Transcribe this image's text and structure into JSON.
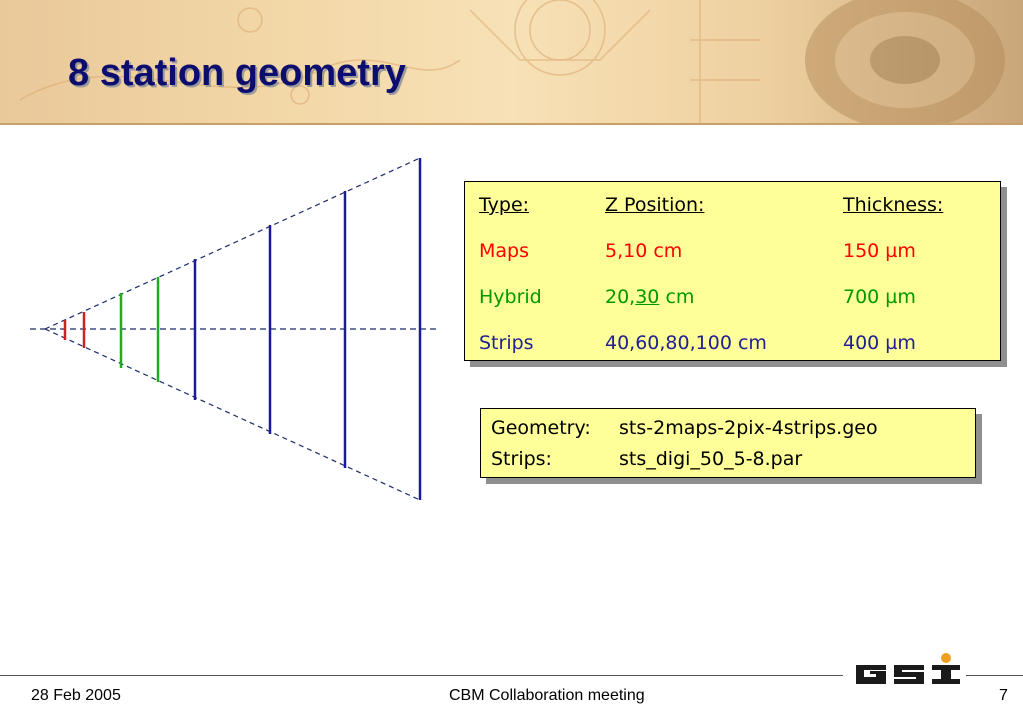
{
  "slide": {
    "title": "8 station geometry",
    "header_background_colors": [
      "#e9c89a",
      "#f7e1b6",
      "#c9a67a"
    ],
    "title_color": "#0c0d6e"
  },
  "diagram": {
    "description_icon": "detector-station-cone",
    "station_colors": {
      "maps": "#cc2222",
      "hybrid": "#22aa22",
      "strips": "#1a1a9a"
    }
  },
  "table": {
    "headers": [
      "Type:",
      "Z Position:",
      "Thickness:"
    ],
    "rows": [
      {
        "type": "Maps",
        "z_before": "5,10 cm",
        "z_under": "",
        "z_after": "",
        "thickness": "150 µm",
        "color": "#ff0000"
      },
      {
        "type": "Hybrid",
        "z_before": "20,",
        "z_under": "30",
        "z_after": " cm",
        "thickness": "700 µm",
        "color": "#009900"
      },
      {
        "type": "Strips",
        "z_before": "40,60,80,100 cm",
        "z_under": "",
        "z_after": "",
        "thickness": "400 µm",
        "color": "#202090"
      }
    ],
    "box_color": "#ffff99"
  },
  "files": {
    "geometry_label": "Geometry:",
    "geometry_value": "sts-2maps-2pix-4strips.geo",
    "strips_label": "Strips:",
    "strips_value": "sts_digi_50_5-8.par"
  },
  "footer": {
    "date": "28 Feb 2005",
    "event": "CBM Collaboration meeting",
    "page": "7",
    "logo_text": "GSI"
  }
}
